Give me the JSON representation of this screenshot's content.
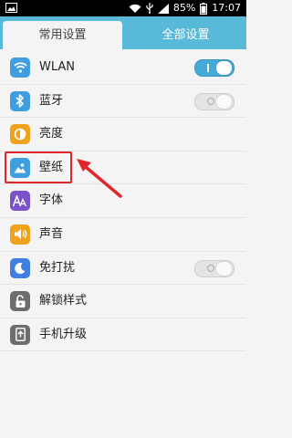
{
  "status_bar": {
    "battery_percent": "85%",
    "time": "17:07",
    "icons": [
      "image-icon",
      "wifi-icon",
      "usb-icon",
      "signal-icon",
      "battery-icon"
    ]
  },
  "tabs": [
    {
      "label": "常用设置",
      "active": true
    },
    {
      "label": "全部设置",
      "active": false
    }
  ],
  "settings": [
    {
      "label": "WLAN",
      "icon": "wifi-icon",
      "toggle": "on"
    },
    {
      "label": "蓝牙",
      "icon": "bluetooth-icon",
      "toggle": "off"
    },
    {
      "label": "亮度",
      "icon": "brightness-icon"
    },
    {
      "label": "壁纸",
      "icon": "wallpaper-icon",
      "highlighted": true
    },
    {
      "label": "字体",
      "icon": "font-icon"
    },
    {
      "label": "声音",
      "icon": "sound-icon"
    },
    {
      "label": "免打扰",
      "icon": "moon-icon",
      "toggle": "off"
    },
    {
      "label": "解锁样式",
      "icon": "unlock-style-icon"
    },
    {
      "label": "手机升级",
      "icon": "system-update-icon"
    }
  ],
  "colors": {
    "tab_bar": "#58b9d8",
    "highlight": "#e0262a",
    "toggle_on": "#46a9d6"
  }
}
